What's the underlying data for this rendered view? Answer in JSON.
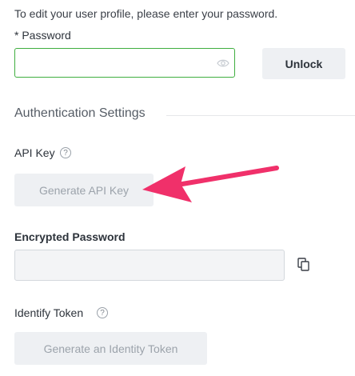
{
  "intro_text": "To edit your user profile, please enter your password.",
  "password": {
    "label": "* Password",
    "value": "",
    "icon": "eye-icon"
  },
  "unlock_label": "Unlock",
  "section_title": "Authentication Settings",
  "api_key": {
    "label": "API Key",
    "help_icon": "?",
    "button_label": "Generate API Key"
  },
  "encrypted_password": {
    "label": "Encrypted Password",
    "value": "",
    "copy_icon": "copy-icon"
  },
  "identify_token": {
    "label": "Identify Token",
    "help_icon": "?",
    "button_label": "Generate an Identity Token"
  },
  "colors": {
    "focus_border": "#3fae3f",
    "annotation_arrow": "#f0306a",
    "disabled_text": "#9ca3ab"
  }
}
